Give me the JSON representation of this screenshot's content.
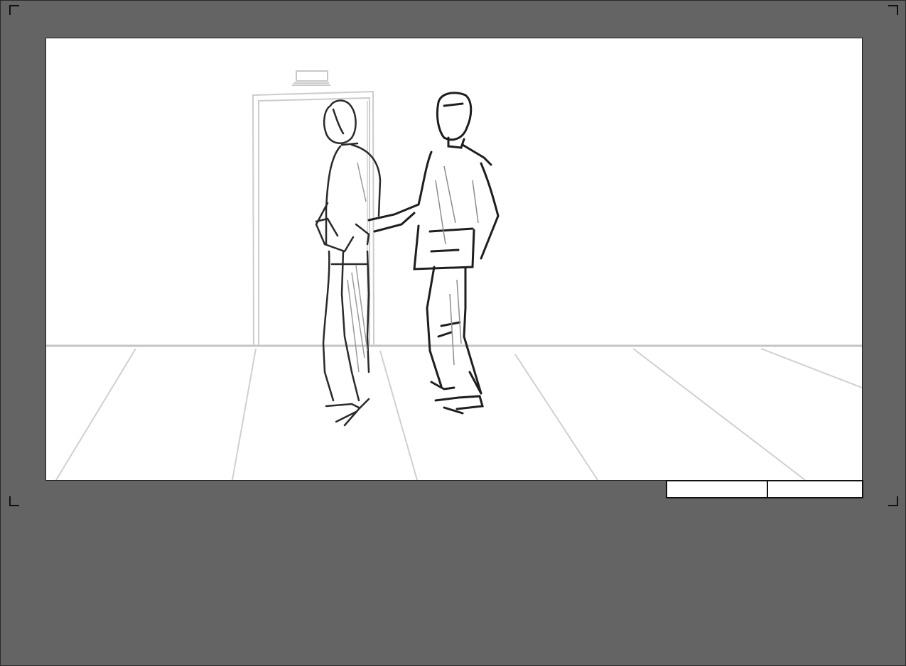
{
  "storyboard": {
    "scene_number": "",
    "shot_number": ""
  },
  "colors": {
    "background": "#646464",
    "panel": "#ffffff",
    "frame": "#1a1a1a",
    "sketch_dark": "#222222",
    "sketch_light": "#c8c8c8"
  },
  "icons": {
    "crop_marks": "corner-crop-mark-icon"
  }
}
